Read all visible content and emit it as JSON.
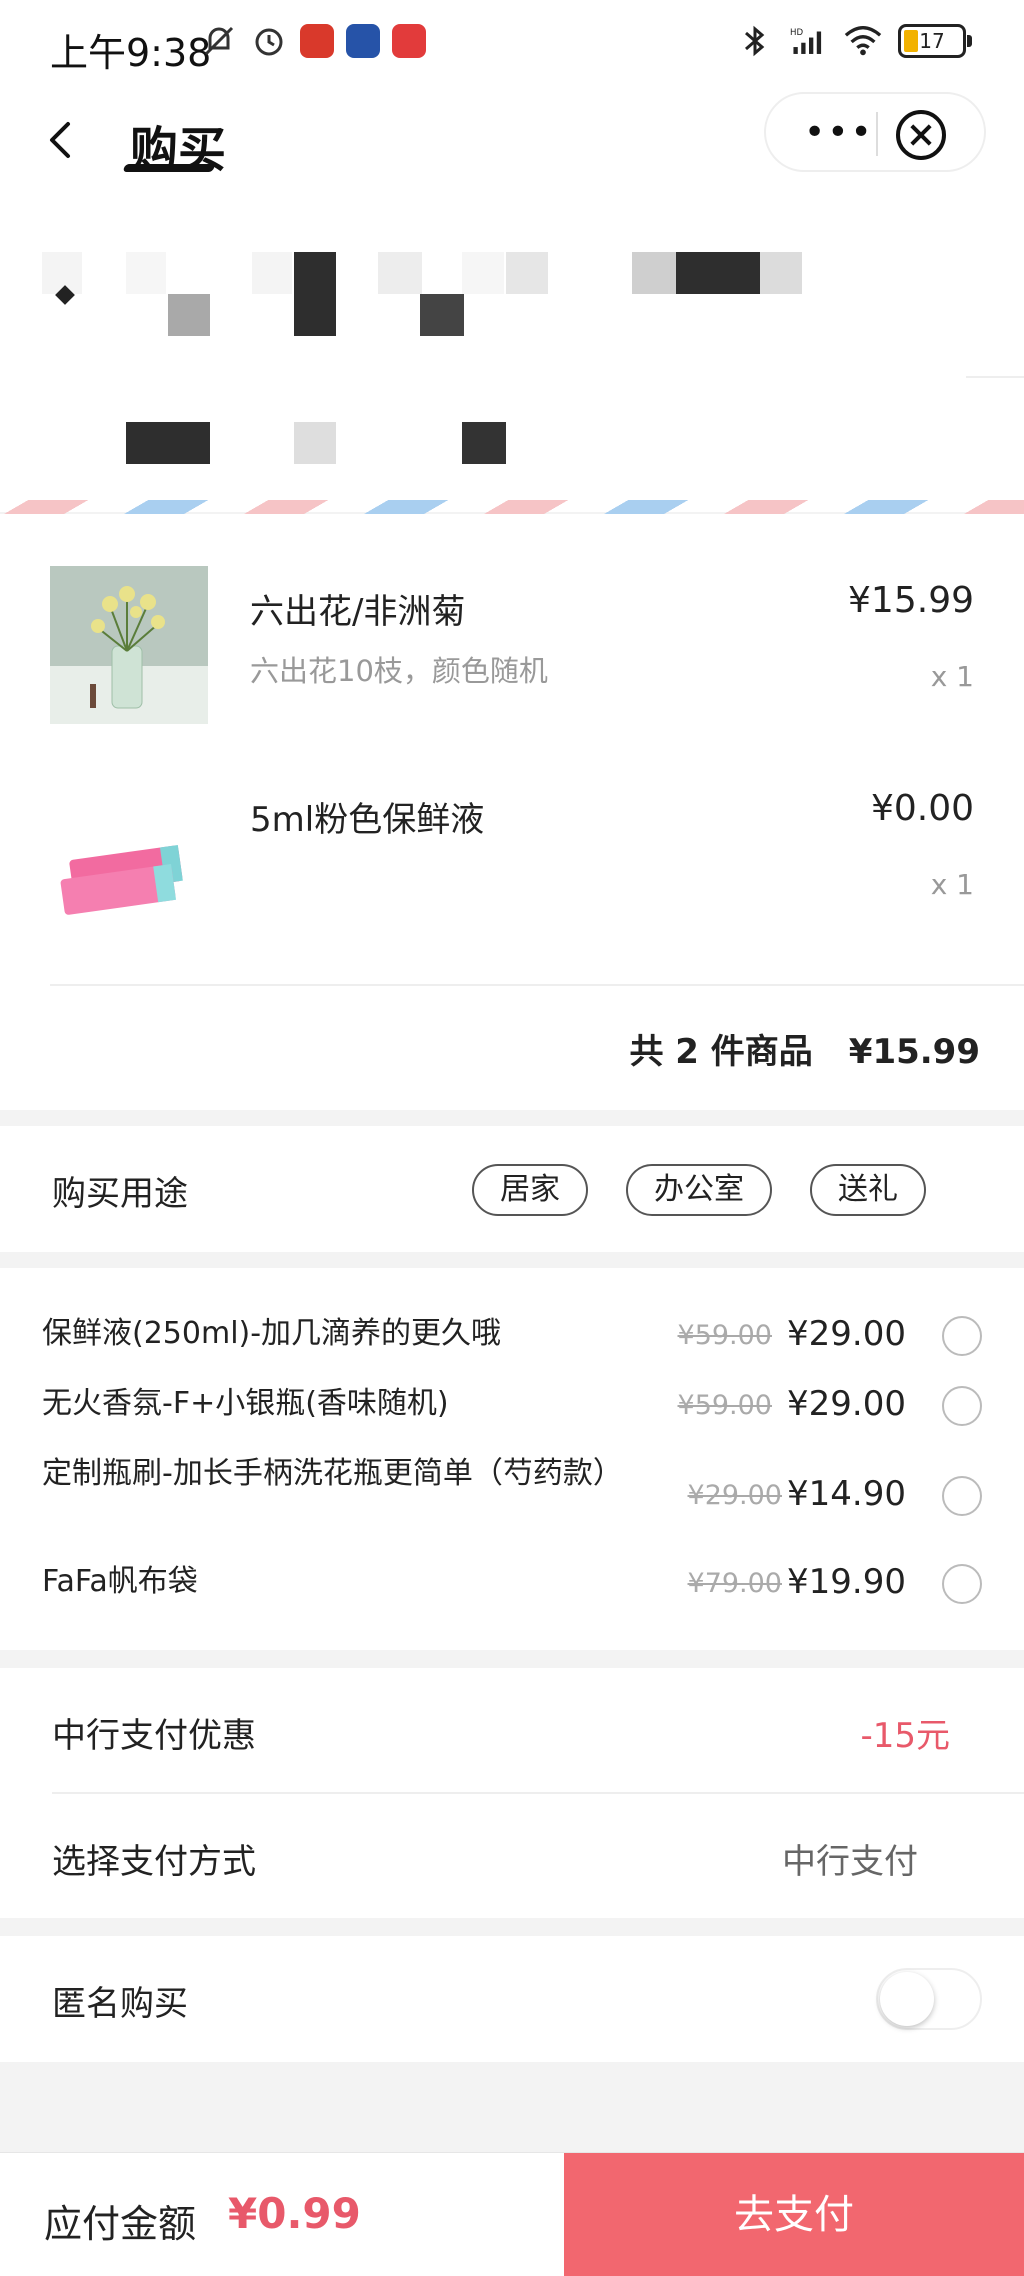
{
  "status_bar": {
    "time": "上午9:38",
    "battery": "17",
    "network": "HD"
  },
  "header": {
    "title": "购买"
  },
  "goods": {
    "items": [
      {
        "name": "六出花/非洲菊",
        "desc": "六出花10枝，颜色随机",
        "price": "¥15.99",
        "qty": "x 1"
      },
      {
        "name": "5ml粉色保鲜液",
        "desc": "",
        "price": "¥0.00",
        "qty": "x 1"
      }
    ],
    "total_label": "共 2 件商品",
    "total_price": "¥15.99"
  },
  "purpose": {
    "label": "购买用途",
    "tags": [
      "居家",
      "办公室",
      "送礼"
    ]
  },
  "addons": [
    {
      "name": "保鲜液(250ml)-加几滴养的更久哦",
      "old_price": "¥59.00",
      "price": "¥29.00"
    },
    {
      "name": "无火香氛-F+小银瓶(香味随机)",
      "old_price": "¥59.00",
      "price": "¥29.00"
    },
    {
      "name": "定制瓶刷-加长手柄洗花瓶更简单（芍药款）",
      "old_price": "¥29.00",
      "price": "¥14.90"
    },
    {
      "name": "FaFa帆布袋",
      "old_price": "¥79.00",
      "price": "¥19.90"
    }
  ],
  "payment": {
    "discount_label": "中行支付优惠",
    "discount_value": "-15元",
    "method_label": "选择支付方式",
    "method_value": "中行支付"
  },
  "anonymous": {
    "label": "匿名购买",
    "enabled": false
  },
  "bottom": {
    "due_label": "应付金额",
    "due_amount": "¥0.99",
    "pay_button": "去支付"
  },
  "colors": {
    "accent": "#f2676f",
    "price_red": "#e8596a"
  }
}
